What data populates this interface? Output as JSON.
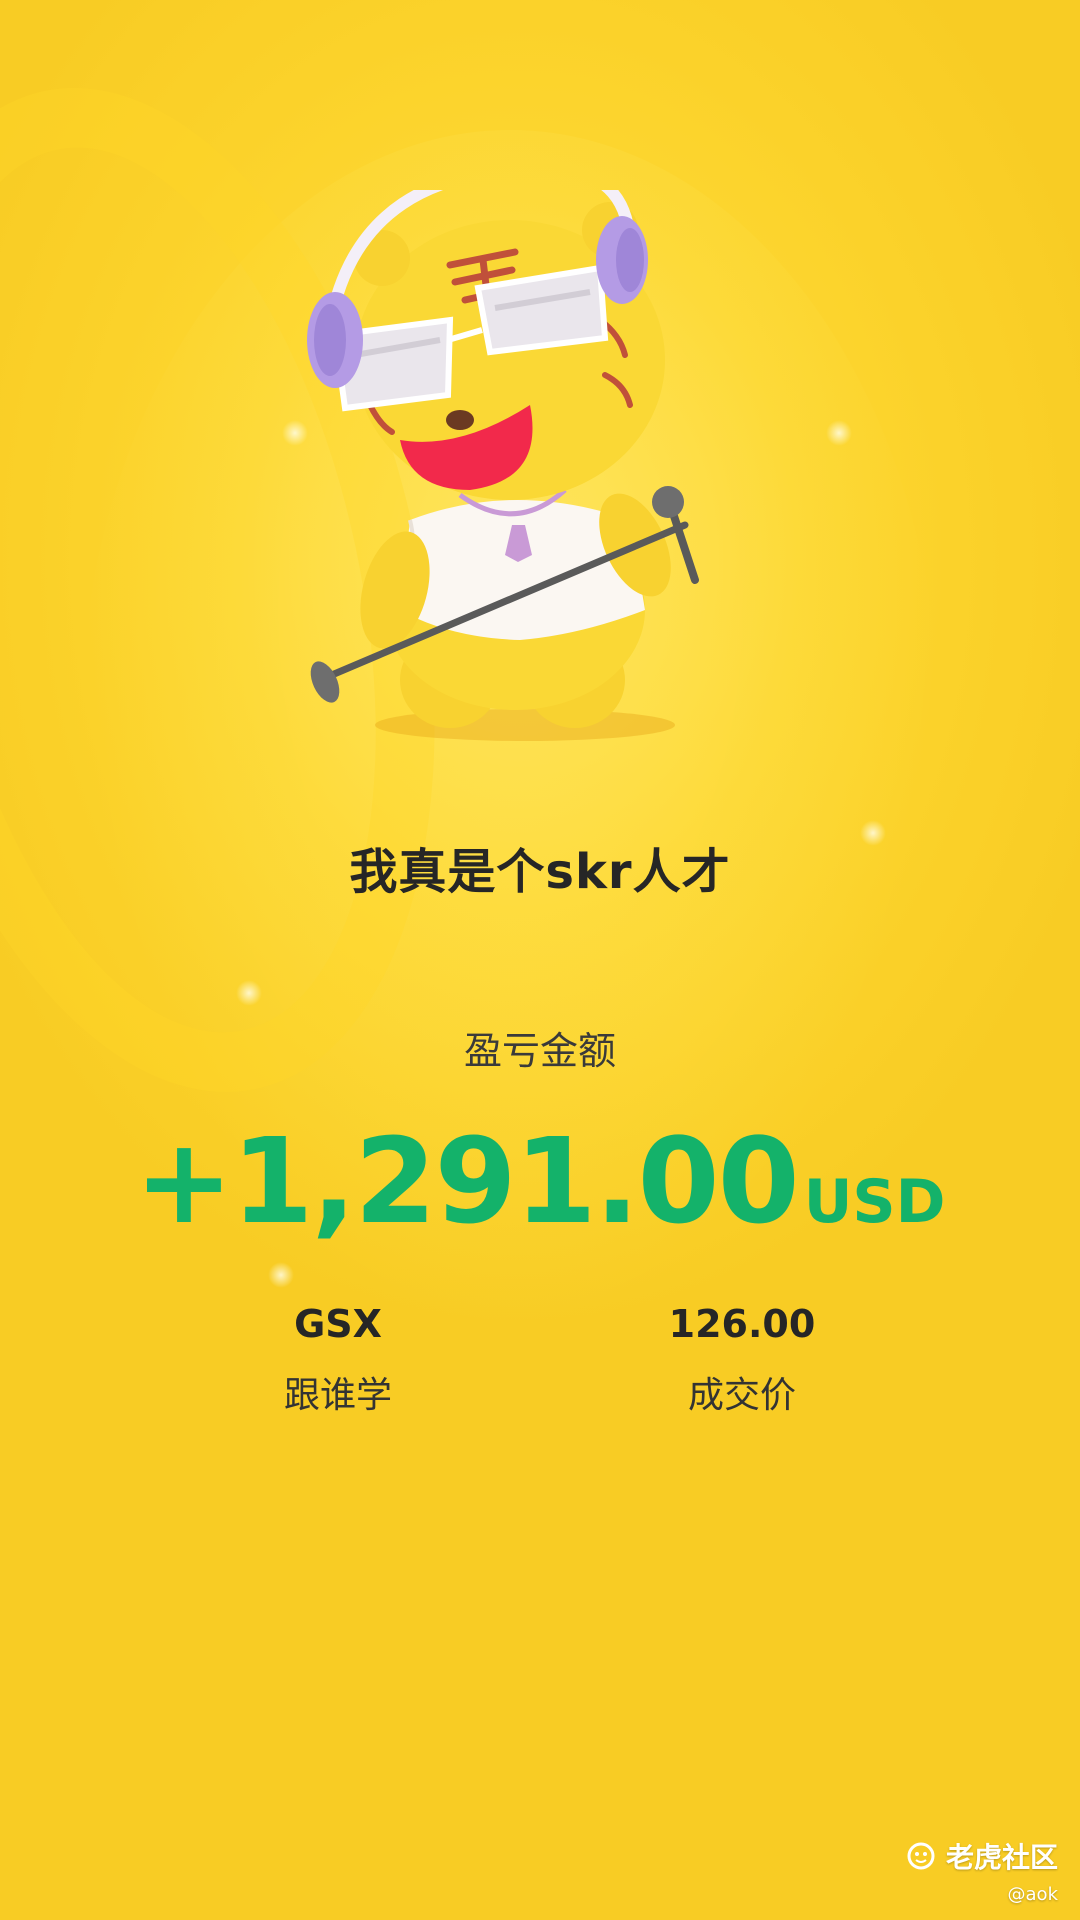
{
  "card": {
    "title": "我真是个skr人才",
    "pnl_label": "盈亏金额",
    "pnl_amount": "+1,291.00",
    "pnl_unit": "USD"
  },
  "stock": {
    "symbol": "GSX",
    "name": "跟谁学"
  },
  "trade": {
    "price": "126.00",
    "price_label": "成交价"
  },
  "watermark": {
    "brand": "老虎社区",
    "handle": "@aok"
  },
  "colors": {
    "background": "#FBD22A",
    "profit_green": "#14B26A",
    "text_dark": "#262626"
  }
}
